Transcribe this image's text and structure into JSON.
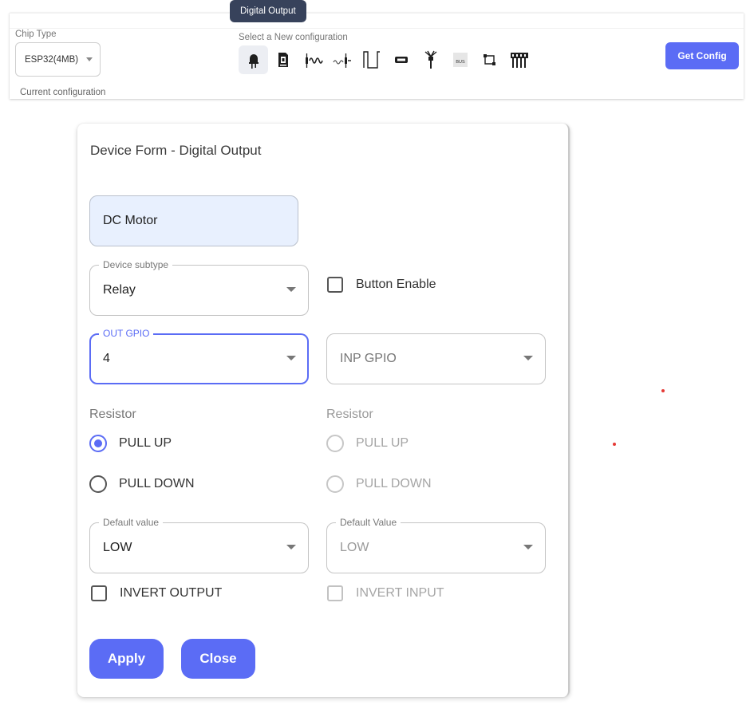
{
  "toolbar": {
    "chip_type_label": "Chip Type",
    "chip_type_value": "ESP32(4MB)",
    "current_configuration_label": "Current configuration",
    "new_configuration_label": "Select a New configuration",
    "tooltip": "Digital Output",
    "get_config_label": "Get Config",
    "config_icons": [
      "led-icon",
      "memory-card-icon",
      "sensor-wave-icon",
      "analog-wave-icon",
      "pulse-icon",
      "display-icon",
      "antenna-icon",
      "bus-icon",
      "connection-icon",
      "pin-header-icon"
    ],
    "bus_icon_text": "BUS"
  },
  "dialog": {
    "title": "Device Form - Digital Output",
    "device_name": "DC Motor",
    "device_subtype": {
      "label": "Device subtype",
      "value": "Relay"
    },
    "button_enable_label": "Button Enable",
    "out_gpio": {
      "label": "OUT GPIO",
      "value": "4"
    },
    "inp_gpio": {
      "placeholder": "INP GPIO"
    },
    "resistor_out": {
      "label": "Resistor",
      "options": [
        "PULL UP",
        "PULL DOWN"
      ],
      "selected": "PULL UP"
    },
    "resistor_in": {
      "label": "Resistor",
      "options": [
        "PULL UP",
        "PULL DOWN"
      ]
    },
    "default_value_out": {
      "label": "Default value",
      "value": "LOW"
    },
    "default_value_in": {
      "label": "Default Value",
      "value": "LOW"
    },
    "invert_output_label": "INVERT OUTPUT",
    "invert_input_label": "INVERT INPUT",
    "apply_label": "Apply",
    "close_label": "Close"
  },
  "colors": {
    "accent": "#5b6cf5",
    "tooltip_bg": "#37425b",
    "autofill_bg": "#e8f0fe",
    "marker_red": "#e53935"
  }
}
